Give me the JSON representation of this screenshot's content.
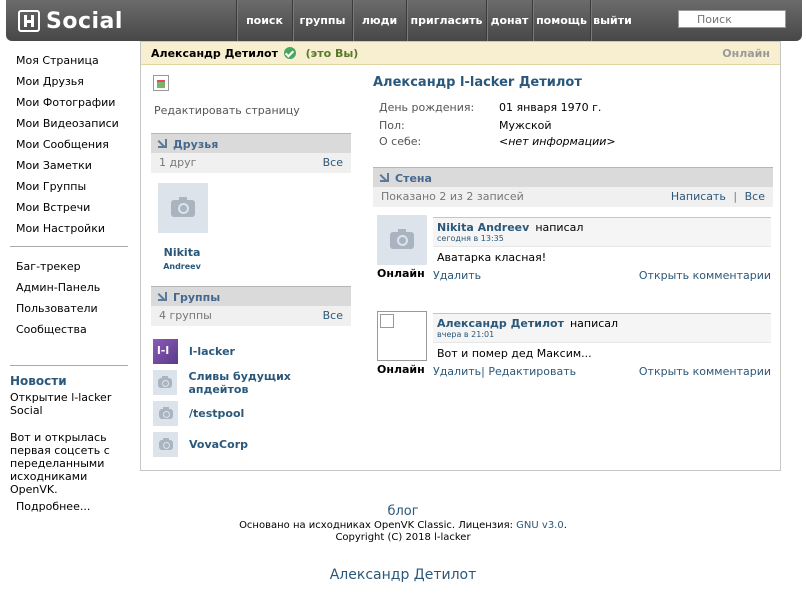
{
  "header": {
    "logo_text": "Social",
    "nav": [
      {
        "label": "поиск",
        "name": "nav-search",
        "w": 56
      },
      {
        "label": "группы",
        "name": "nav-groups",
        "w": 60
      },
      {
        "label": "люди",
        "name": "nav-people",
        "w": 54
      },
      {
        "label": "пригласить",
        "name": "nav-invite",
        "w": 80
      },
      {
        "label": "донат",
        "name": "nav-donate",
        "w": 46
      },
      {
        "label": "помощь",
        "name": "nav-help",
        "w": 58
      },
      {
        "label": "выйти",
        "name": "nav-logout",
        "w": 44
      }
    ],
    "search_placeholder": "Поиск"
  },
  "leftmenu": {
    "items": [
      "Моя Страница",
      "Мои Друзья",
      "Мои Фотографии",
      "Мои Видеозаписи",
      "Мои Сообщения",
      "Мои Заметки",
      "Мои Группы",
      "Мои Встречи",
      "Мои Настройки"
    ],
    "extra": [
      "Баг-трекер",
      "Админ-Панель",
      "Пользователи",
      "Сообщества"
    ]
  },
  "news": {
    "title": "Новости",
    "item1": "Открытие l-lacker Social",
    "item2": "Вот и открылась первая соцсеть с переделанными исходниками OpenVK.",
    "more": "Подробнее..."
  },
  "profile": {
    "name": "Александр Детилот",
    "you_label": "(это Вы)",
    "online_label": "Онлайн",
    "full_name": "Александр l-lacker Детилот",
    "edit_link": "Редактировать страницу",
    "info": [
      {
        "key": "День рождения:",
        "value": "01 января 1970 г."
      },
      {
        "key": "Пол:",
        "value": "Мужской"
      },
      {
        "key": "О себе:",
        "value": "<нет информации>"
      }
    ]
  },
  "friends": {
    "title": "Друзья",
    "count": "1 друг",
    "all": "Все",
    "first_name": "Nikita",
    "last_name": "Andreev"
  },
  "groups": {
    "title": "Группы",
    "count": "4 группы",
    "all": "Все",
    "items": [
      "l-lacker",
      "Сливы будущих апдейтов",
      "/testpool",
      "VovaCorp"
    ]
  },
  "wall": {
    "title": "Стена",
    "shown": "Показано 2 из 2 записей",
    "write": "Написать",
    "separator": "|",
    "all": "Все",
    "posts": [
      {
        "author": "Nikita Andreev",
        "wrote": "написал",
        "time": "сегодня в 13:35",
        "text": "Аватарка класная!",
        "status": "Онлайн",
        "delete": "Удалить",
        "edit": "",
        "comments": "Открыть комментарии"
      },
      {
        "author": "Александр Детилот",
        "wrote": "написал",
        "time": "вчера в 21:01",
        "text": "Вот и помер дед Максим...",
        "status": "Онлайн",
        "delete": "Удалить|",
        "edit": "Редактировать",
        "comments": "Открыть комментарии"
      }
    ]
  },
  "footer": {
    "blog": "блог",
    "license_prefix": "Основано на исходниках OpenVK Classic. Лицензия:",
    "license_link": "GNU v3.0",
    "license_suffix": ".",
    "copyright": "Copyright (C) 2018 l-lacker",
    "bottom_name": "Александр Детилот"
  },
  "colors": {
    "link": "#2b587a",
    "header_bg": "#575757",
    "profile_bar": "#f7efcf",
    "section_bar": "#dadada"
  }
}
